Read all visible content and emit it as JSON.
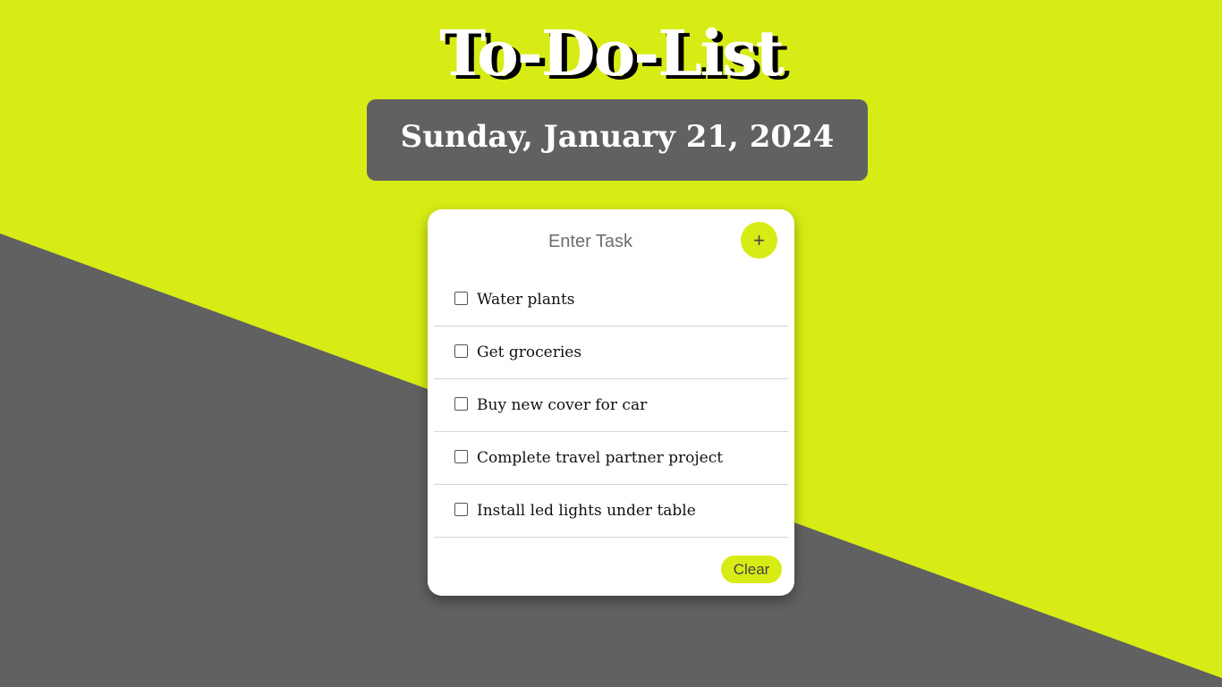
{
  "app": {
    "title": "To-Do-List",
    "date": "Sunday, January 21, 2024"
  },
  "colors": {
    "accent": "#d7ec14",
    "dark": "#616161",
    "card": "#ffffff"
  },
  "input": {
    "placeholder": "Enter Task",
    "value": ""
  },
  "add_button": {
    "label": "+"
  },
  "tasks": [
    {
      "label": "Water plants",
      "checked": false
    },
    {
      "label": "Get groceries",
      "checked": false
    },
    {
      "label": "Buy new cover for car",
      "checked": false
    },
    {
      "label": "Complete travel partner project",
      "checked": false
    },
    {
      "label": "Install led lights under table",
      "checked": false
    }
  ],
  "clear_button": {
    "label": "Clear"
  }
}
